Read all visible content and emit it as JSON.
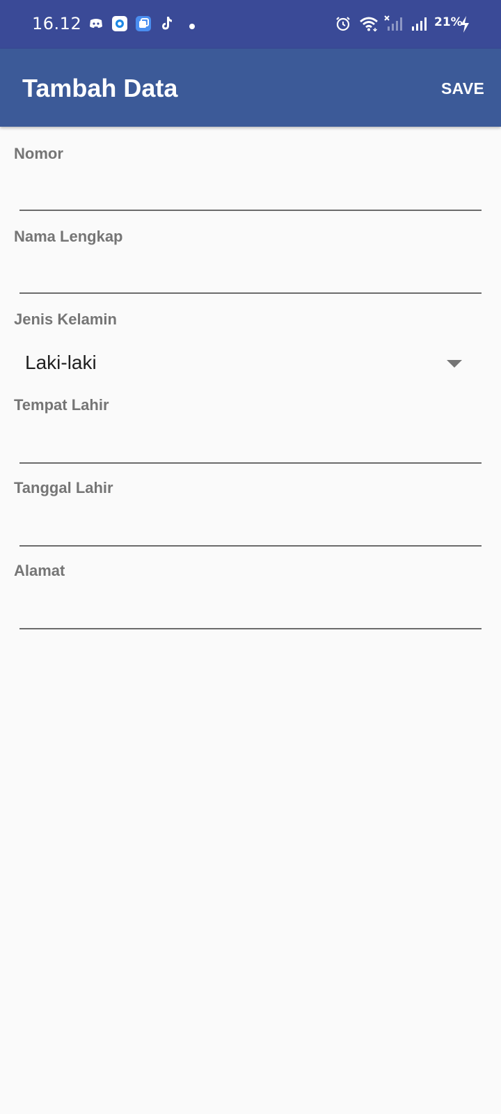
{
  "status_bar": {
    "time": "16.12",
    "battery": "21%",
    "icons": [
      "discord-icon",
      "circle-app-icon",
      "multitask-app-icon",
      "tiktok-icon",
      "notification-dot-icon",
      "alarm-icon",
      "wifi-icon",
      "signal-sim1-disabled-icon",
      "signal-sim2-icon",
      "charging-icon"
    ]
  },
  "app_bar": {
    "title": "Tambah Data",
    "save_label": "SAVE",
    "color": "#3c5a98"
  },
  "form": {
    "nomor": {
      "label": "Nomor",
      "value": ""
    },
    "nama_lengkap": {
      "label": "Nama Lengkap",
      "value": ""
    },
    "jenis_kelamin": {
      "label": "Jenis Kelamin",
      "selected": "Laki-laki"
    },
    "tempat_lahir": {
      "label": "Tempat Lahir",
      "value": ""
    },
    "tanggal_lahir": {
      "label": "Tanggal Lahir",
      "value": ""
    },
    "alamat": {
      "label": "Alamat",
      "value": ""
    }
  },
  "colors": {
    "status_bar": "#3a4a97",
    "label": "#757575",
    "background": "#fafafa"
  }
}
